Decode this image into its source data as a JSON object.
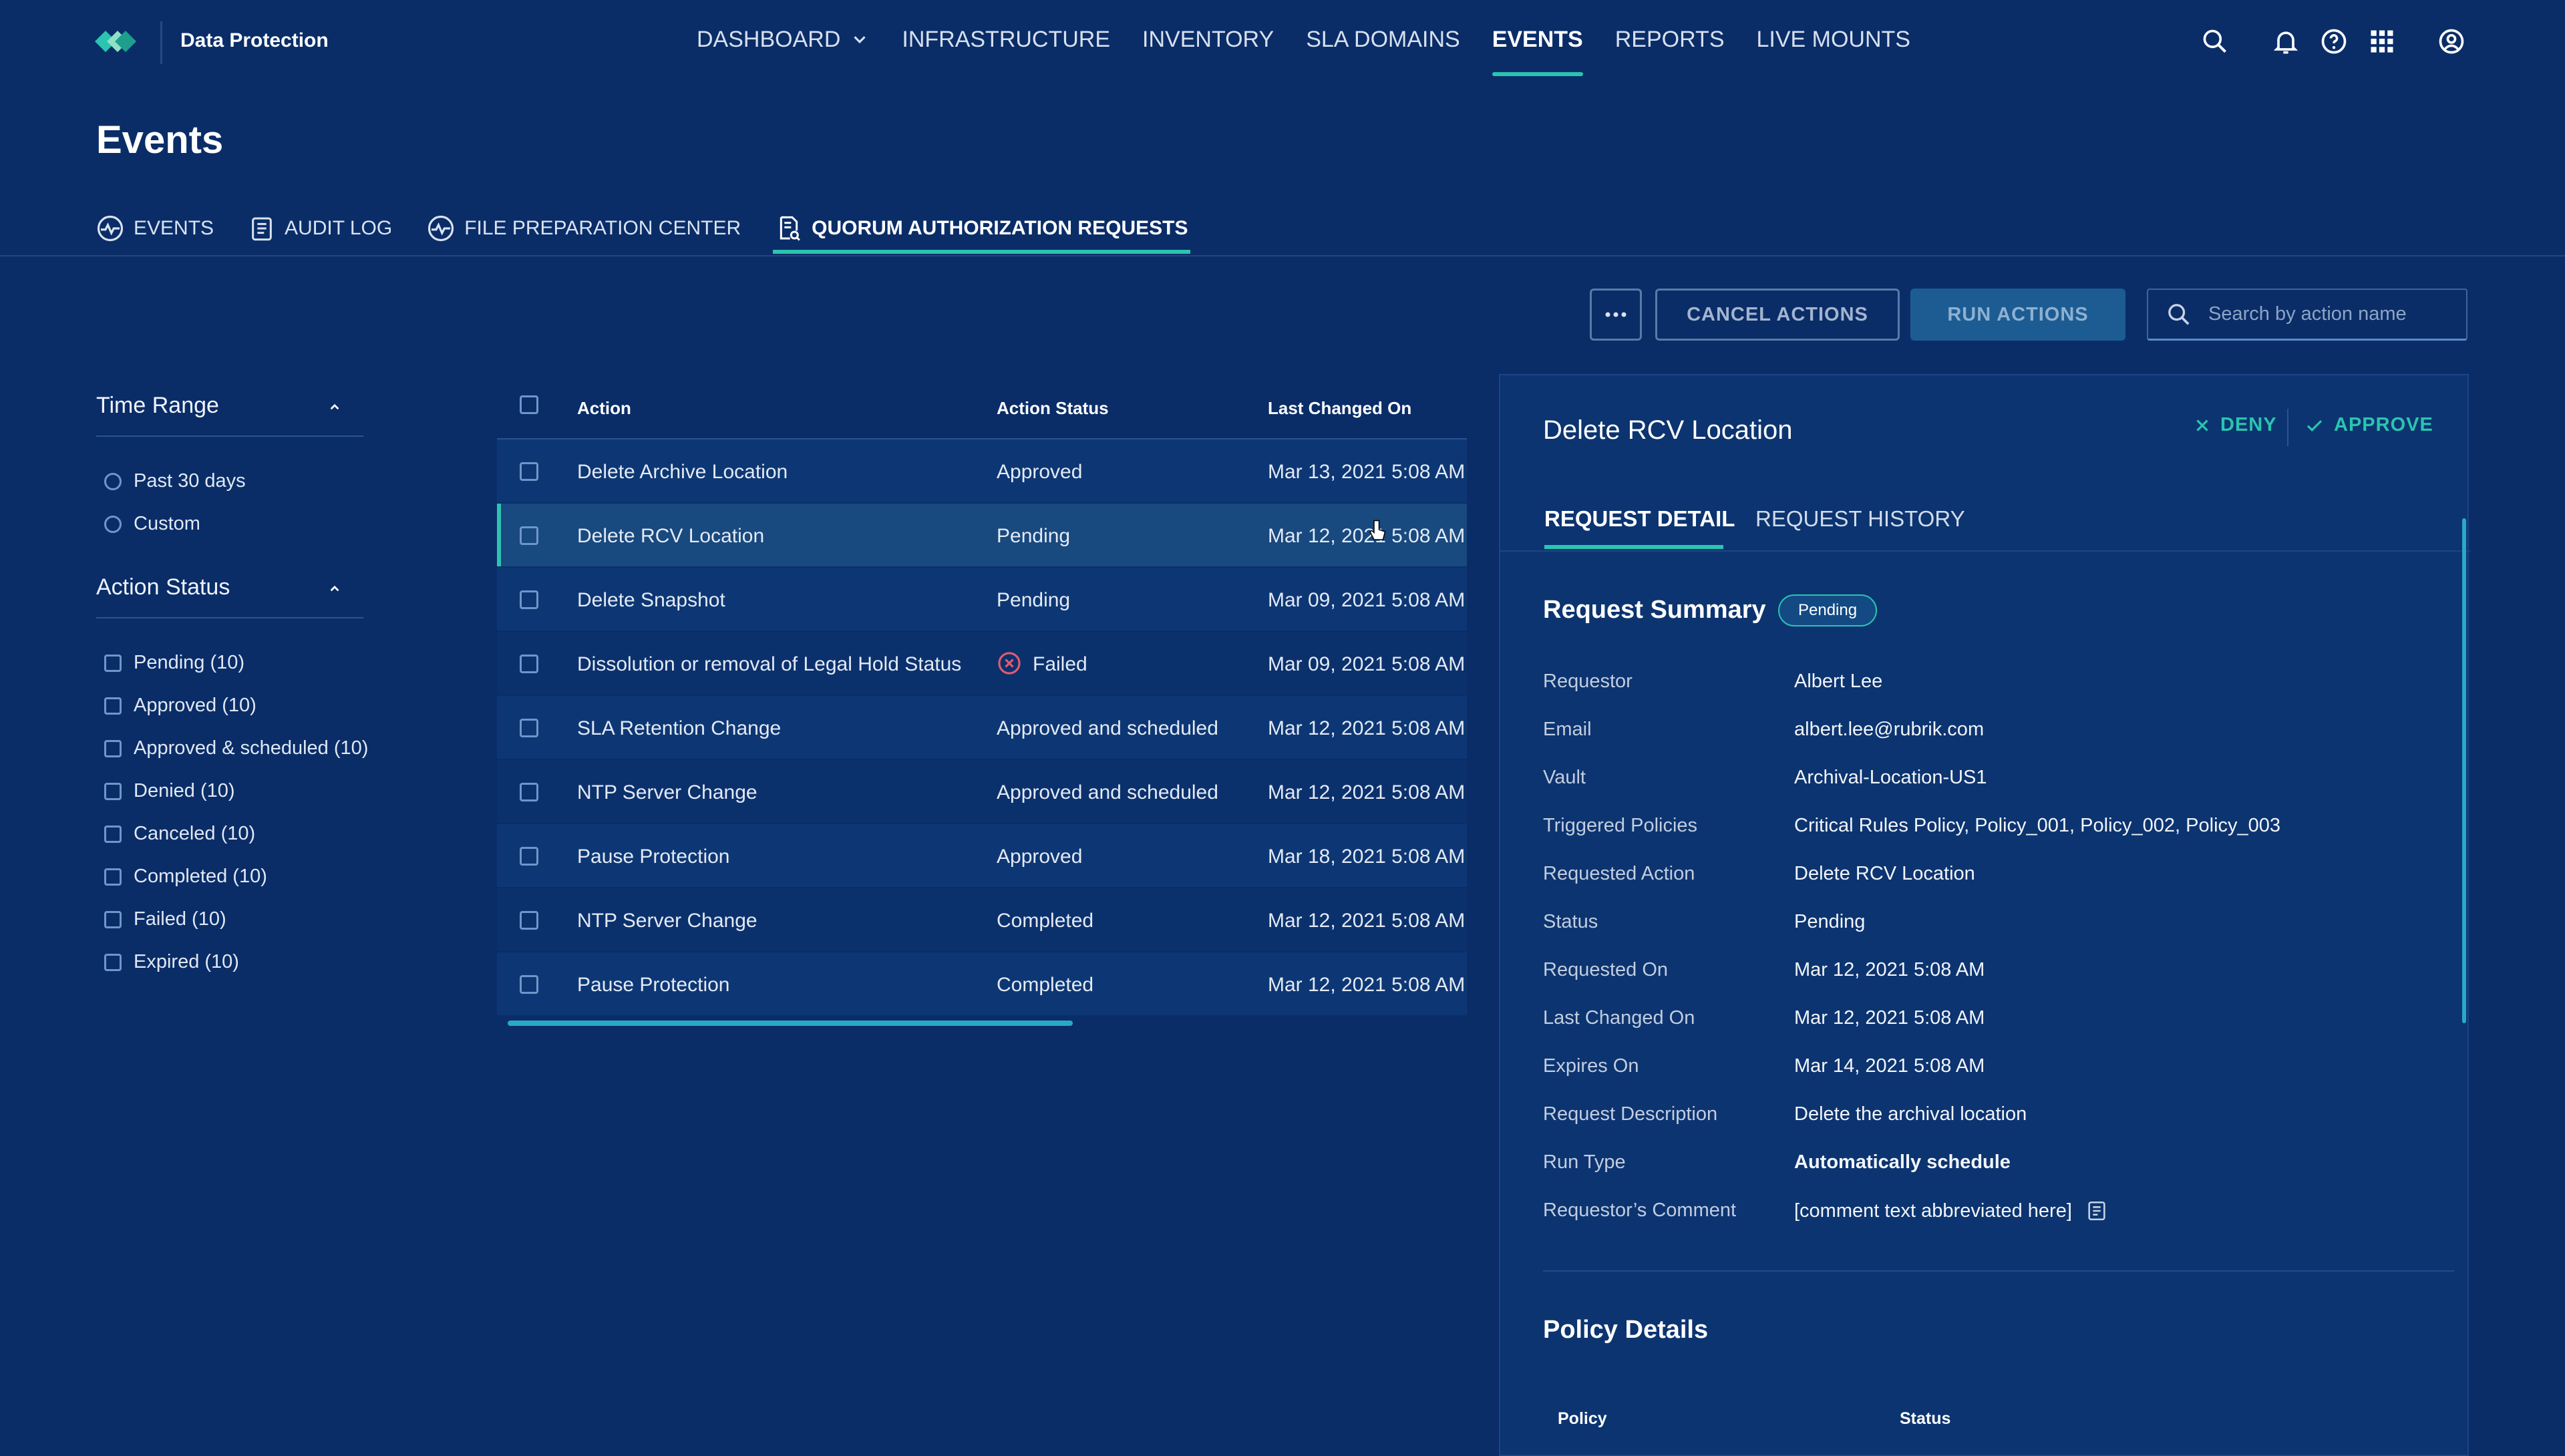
{
  "colors": {
    "background": "#0a2d68",
    "accent": "#2bc4b0",
    "failed": "#e25a6e",
    "selected_row": "#18497f"
  },
  "app": {
    "name": "Data Protection"
  },
  "nav": {
    "items": [
      {
        "label": "DASHBOARD",
        "active": false
      },
      {
        "label": "INFRASTRUCTURE",
        "active": false
      },
      {
        "label": "INVENTORY",
        "active": false
      },
      {
        "label": "SLA DOMAINS",
        "active": false
      },
      {
        "label": "EVENTS",
        "active": true
      },
      {
        "label": "REPORTS",
        "active": false
      },
      {
        "label": "LIVE MOUNTS",
        "active": false
      }
    ],
    "icons": [
      "search-icon",
      "bell-icon",
      "help-icon",
      "apps-grid-icon",
      "user-account-icon"
    ]
  },
  "page": {
    "title": "Events"
  },
  "subtabs": [
    {
      "label": "EVENTS",
      "icon": "activity-icon"
    },
    {
      "label": "AUDIT LOG",
      "icon": "clipboard-icon"
    },
    {
      "label": "FILE PREPARATION CENTER",
      "icon": "activity-icon"
    },
    {
      "label": "QUORUM AUTHORIZATION REQUESTS",
      "icon": "document-search-icon",
      "active": true
    }
  ],
  "toolbar": {
    "cancel_label": "CANCEL ACTIONS",
    "run_label": "RUN ACTIONS",
    "search_placeholder": "Search by action name"
  },
  "filters": {
    "time_range": {
      "title": "Time Range",
      "options": [
        "Past 30 days",
        "Custom"
      ]
    },
    "action_status": {
      "title": "Action Status",
      "options": [
        "Pending (10)",
        "Approved (10)",
        "Approved & scheduled (10)",
        "Denied (10)",
        "Canceled (10)",
        "Completed (10)",
        "Failed (10)",
        "Expired (10)"
      ]
    }
  },
  "table": {
    "columns": [
      "Action",
      "Action Status",
      "Last Changed On"
    ],
    "rows": [
      {
        "action": "Delete Archive Location",
        "status": "Approved",
        "changed": "Mar 13, 2021 5:08 AM"
      },
      {
        "action": "Delete RCV Location",
        "status": "Pending",
        "changed": "Mar 12, 2021 5:08 AM",
        "selected": true
      },
      {
        "action": "Delete Snapshot",
        "status": "Pending",
        "changed": "Mar 09, 2021 5:08 AM"
      },
      {
        "action": "Dissolution or removal of Legal Hold Status",
        "status": "Failed",
        "changed": "Mar 09, 2021 5:08 AM",
        "status_icon": "error-circle-icon"
      },
      {
        "action": "SLA Retention Change",
        "status": "Approved and scheduled",
        "changed": "Mar 12, 2021 5:08 AM"
      },
      {
        "action": "NTP Server Change",
        "status": "Approved and scheduled",
        "changed": "Mar 12, 2021 5:08 AM"
      },
      {
        "action": "Pause Protection",
        "status": "Approved",
        "changed": "Mar 18, 2021 5:08 AM"
      },
      {
        "action": "NTP Server Change",
        "status": "Completed",
        "changed": "Mar 12, 2021 5:08 AM"
      },
      {
        "action": "Pause Protection",
        "status": "Completed",
        "changed": "Mar 12, 2021 5:08 AM"
      }
    ]
  },
  "detail": {
    "title": "Delete RCV Location",
    "deny_label": "DENY",
    "approve_label": "APPROVE",
    "tabs": [
      "REQUEST DETAIL",
      "REQUEST HISTORY"
    ],
    "summary_title": "Request Summary",
    "status_badge": "Pending",
    "fields": [
      {
        "label": "Requestor",
        "value": "Albert Lee"
      },
      {
        "label": "Email",
        "value": "albert.lee@rubrik.com"
      },
      {
        "label": "Vault",
        "value": "Archival-Location-US1"
      },
      {
        "label": "Triggered Policies",
        "value": "Critical Rules Policy, Policy_001, Policy_002, Policy_003"
      },
      {
        "label": "Requested Action",
        "value": "Delete RCV Location"
      },
      {
        "label": "Status",
        "value": "Pending"
      },
      {
        "label": "Requested On",
        "value": "Mar 12, 2021 5:08 AM"
      },
      {
        "label": "Last Changed On",
        "value": "Mar 12, 2021 5:08 AM"
      },
      {
        "label": "Expires On",
        "value": "Mar 14, 2021 5:08 AM"
      },
      {
        "label": "Request Description",
        "value": "Delete the archival location"
      },
      {
        "label": "Run Type",
        "value": "Automatically schedule"
      },
      {
        "label": "Requestor’s Comment",
        "value": "[comment text abbreviated here]"
      }
    ],
    "policy_title": "Policy Details",
    "policy_columns": [
      "Policy",
      "Status"
    ]
  }
}
